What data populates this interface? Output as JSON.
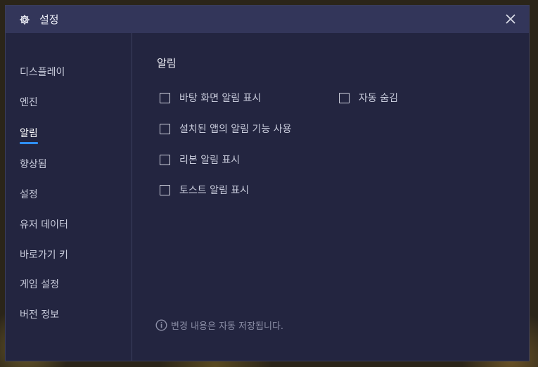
{
  "window": {
    "title": "설정",
    "title_icon": "gear-icon",
    "close_icon": "close-icon"
  },
  "sidebar": {
    "items": [
      {
        "label": "디스플레이",
        "active": false
      },
      {
        "label": "엔진",
        "active": false
      },
      {
        "label": "알림",
        "active": true
      },
      {
        "label": "향상됨",
        "active": false
      },
      {
        "label": "설정",
        "active": false
      },
      {
        "label": "유저 데이터",
        "active": false
      },
      {
        "label": "바로가기 키",
        "active": false
      },
      {
        "label": "게임 설정",
        "active": false
      },
      {
        "label": "버전 정보",
        "active": false
      }
    ]
  },
  "main": {
    "section_title": "알림",
    "options": [
      {
        "label": "바탕 화면 알림 표시",
        "checked": false
      },
      {
        "label": "자동 숨김",
        "checked": false
      },
      {
        "label": "설치된 앱의 알림 기능 사용",
        "checked": false
      },
      {
        "label": "리본 알림 표시",
        "checked": false
      },
      {
        "label": "토스트 알림 표시",
        "checked": false
      }
    ],
    "footer_note": "변경 내용은 자동 저장됩니다.",
    "footer_icon": "info-icon"
  },
  "colors": {
    "accent": "#2f8ff5",
    "dialog_bg": "#232540",
    "titlebar_bg": "#33365a"
  }
}
